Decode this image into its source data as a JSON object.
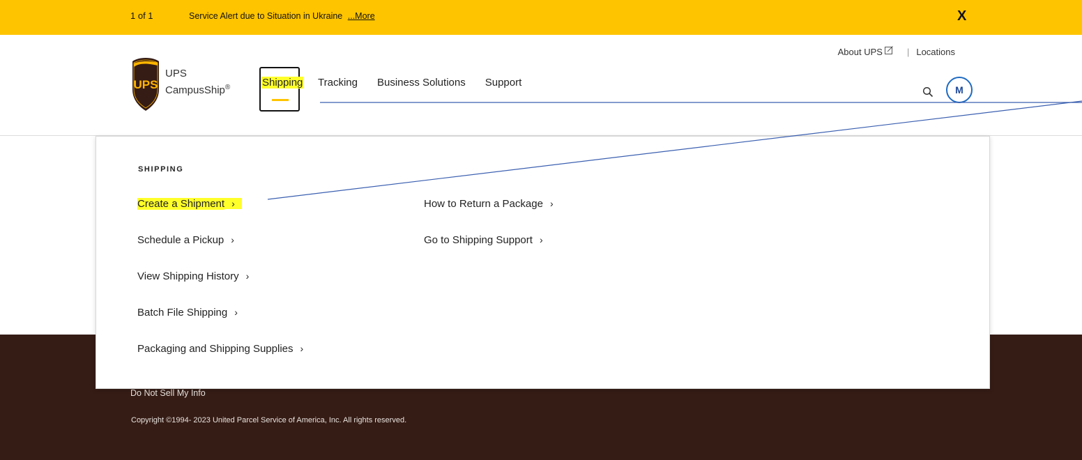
{
  "alert": {
    "counter": "1 of 1",
    "message": "Service Alert due to Situation in Ukraine",
    "more_label": "...More",
    "close_label": "X"
  },
  "header": {
    "brand_line1": "UPS",
    "brand_line2": "CampusShip",
    "registered": "®",
    "logo_text": "UPS",
    "utility": {
      "about_label": "About UPS",
      "separator": "|",
      "locations_label": "Locations"
    },
    "nav": [
      {
        "label": "Shipping",
        "active": true
      },
      {
        "label": "Tracking"
      },
      {
        "label": "Business Solutions"
      },
      {
        "label": "Support"
      }
    ],
    "avatar_initial": "M",
    "icons": {
      "search": "search-icon",
      "external": "external-link-icon"
    }
  },
  "dropdown": {
    "heading": "SHIPPING",
    "column1": [
      {
        "label": "Create a Shipment",
        "highlighted": true
      },
      {
        "label": "Schedule a Pickup"
      },
      {
        "label": "View Shipping History"
      },
      {
        "label": "Batch File Shipping"
      },
      {
        "label": "Packaging and Shipping Supplies"
      }
    ],
    "column2": [
      {
        "label": "How to Return a Package"
      },
      {
        "label": "Go to Shipping Support"
      }
    ],
    "chevron": "›"
  },
  "footer": {
    "link": "Do Not Sell My Info",
    "copyright": "Copyright ©1994- 2023  United Parcel Service of America, Inc. All rights reserved."
  },
  "colors": {
    "alert_bg": "#ffc400",
    "footer_bg": "#351c15",
    "highlight": "#ffff2a",
    "avatar_ring": "#1e6ac1",
    "ups_brown": "#351c15",
    "ups_gold": "#ffb500"
  }
}
